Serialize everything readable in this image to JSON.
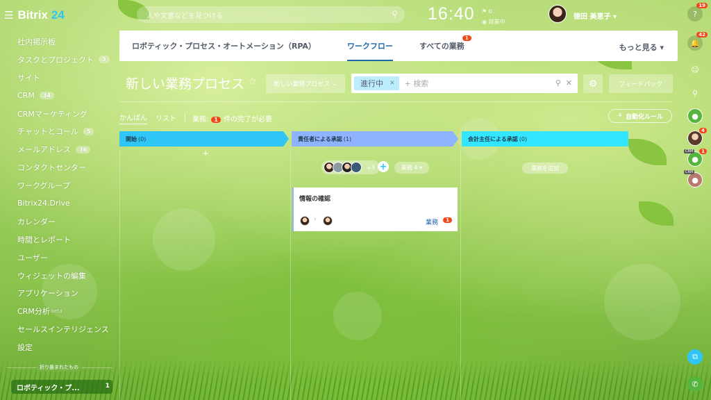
{
  "app": {
    "logo_name": "Bitrix",
    "logo_num": "24"
  },
  "header": {
    "search_placeholder": "人や文書などを見つける",
    "clock": "16:40",
    "status_line1": "0",
    "status_line2": "就業中",
    "username": "徳田 美恵子"
  },
  "sidebar": {
    "items": [
      {
        "label": "社内掲示板",
        "badge": ""
      },
      {
        "label": "タスクとプロジェクト",
        "badge": "3"
      },
      {
        "label": "サイト",
        "badge": ""
      },
      {
        "label": "CRM",
        "badge": "34"
      },
      {
        "label": "CRMマーケティング",
        "badge": ""
      },
      {
        "label": "チャットとコール",
        "badge": "5"
      },
      {
        "label": "メールアドレス",
        "badge": "36"
      },
      {
        "label": "コンタクトセンター",
        "badge": ""
      },
      {
        "label": "ワークグループ",
        "badge": ""
      },
      {
        "label": "Bitrix24.Drive",
        "badge": ""
      },
      {
        "label": "カレンダー",
        "badge": ""
      },
      {
        "label": "時間とレポート",
        "badge": ""
      },
      {
        "label": "ユーザー",
        "badge": ""
      },
      {
        "label": "ウィジェットの編集",
        "badge": ""
      },
      {
        "label": "アプリケーション",
        "badge": ""
      },
      {
        "label": "CRM分析",
        "badge": "",
        "beta": "beta"
      },
      {
        "label": "セールスインテリジェンス",
        "badge": ""
      },
      {
        "label": "設定",
        "badge": ""
      }
    ],
    "collapsed_label": "折り畳まれたもの",
    "pinned_label": "ロボティック・プ...",
    "pinned_count": "1"
  },
  "right_bar": {
    "help_badge": "19",
    "bell_badge": "42",
    "group_badge": "4",
    "crm_badge": "1",
    "crm_tag": "CRM"
  },
  "tabs": [
    {
      "label": "ロボティック・プロセス・オートメーション（RPA）",
      "active": false
    },
    {
      "label": "ワークフロー",
      "active": true
    },
    {
      "label": "すべての業務",
      "active": false,
      "badge": "1"
    }
  ],
  "more_label": "もっと見る",
  "toolbar": {
    "title": "新しい業務プロセス",
    "preset_label": "新しい業務プロセス",
    "chip_label": "進行中",
    "filter_placeholder": "+ 検索",
    "feedback_label": "フィードバック"
  },
  "views": {
    "kanban": "かんばん",
    "list": "リスト",
    "tasks_prefix": "業務:",
    "tasks_count": "1",
    "tasks_suffix": "件の完了が必要",
    "automation_label": "自動化ルール"
  },
  "columns": [
    {
      "name": "開始",
      "count": "(0)",
      "color": "#2fc6f6"
    },
    {
      "name": "責任者による承認",
      "count": "(1)",
      "color": "#8fb3ff"
    },
    {
      "name": "会計主任による承認",
      "count": "(0)",
      "color": "#33e6ff"
    }
  ],
  "column2": {
    "avatars_more": "+3",
    "task_pill": "業務 4"
  },
  "column3": {
    "add_task": "業務を追加"
  },
  "card": {
    "title": "情報の確認",
    "tasks_label": "業務",
    "tasks_badge": "1"
  }
}
